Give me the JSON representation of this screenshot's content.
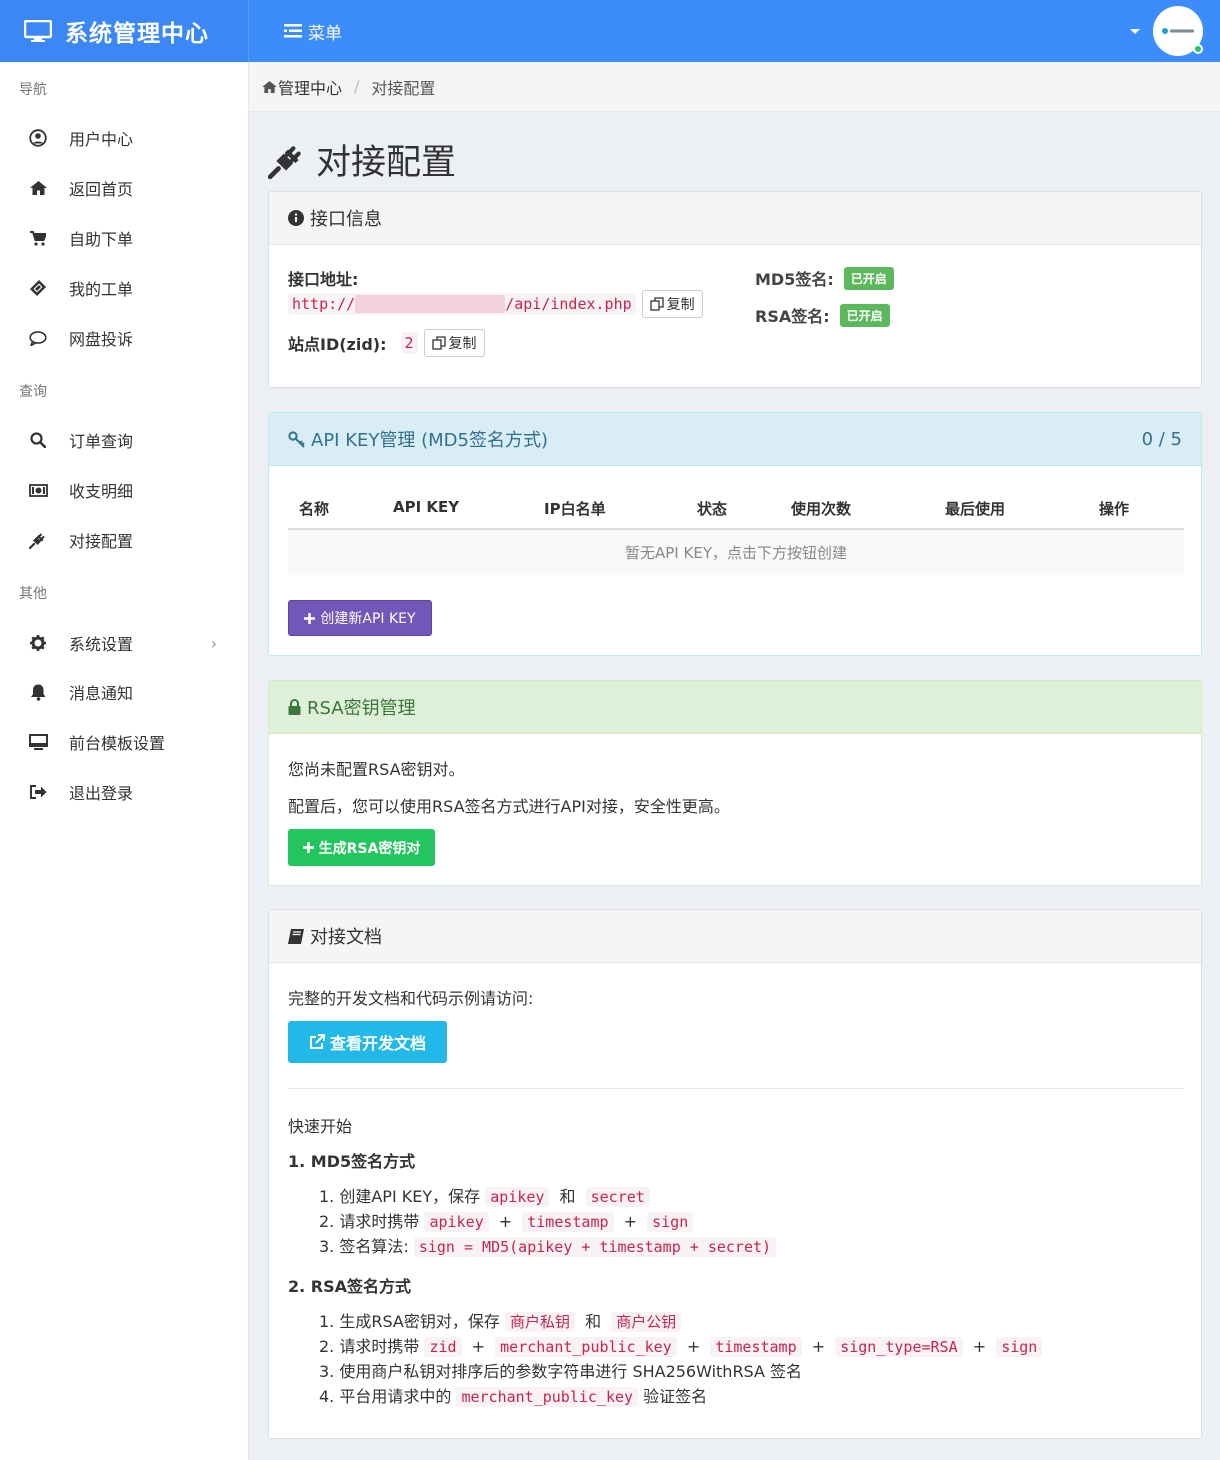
{
  "header": {
    "brand": "系统管理中心",
    "menu_label": "菜单"
  },
  "sidebar": {
    "sections": [
      "导航",
      "查询",
      "其他"
    ],
    "items": [
      {
        "label": "用户中心",
        "icon": "user-circle-icon"
      },
      {
        "label": "返回首页",
        "icon": "home-icon"
      },
      {
        "label": "自助下单",
        "icon": "cart-icon"
      },
      {
        "label": "我的工单",
        "icon": "ticket-icon"
      },
      {
        "label": "网盘投诉",
        "icon": "comment-icon"
      },
      {
        "label": "订单查询",
        "icon": "search-icon"
      },
      {
        "label": "收支明细",
        "icon": "money-icon"
      },
      {
        "label": "对接配置",
        "icon": "plug-icon"
      },
      {
        "label": "系统设置",
        "icon": "gear-icon"
      },
      {
        "label": "消息通知",
        "icon": "bell-icon"
      },
      {
        "label": "前台模板设置",
        "icon": "desktop-icon"
      },
      {
        "label": "退出登录",
        "icon": "sign-out-icon"
      }
    ]
  },
  "breadcrumb": {
    "home": "管理中心",
    "separator": "/",
    "current": "对接配置"
  },
  "page_title": "对接配置",
  "interface_panel": {
    "title": "接口信息",
    "api_url_label": "接口地址:",
    "api_url_prefix": "http://",
    "api_url_suffix": "/api/index.php",
    "copy_label": "复制",
    "site_id_label": "站点ID(zid):",
    "site_id_value": "2",
    "md5_label": "MD5签名:",
    "md5_status": "已开启",
    "rsa_label": "RSA签名:",
    "rsa_status": "已开启"
  },
  "apikey_panel": {
    "title": "API KEY管理 (MD5签名方式)",
    "count": "0 / 5",
    "columns": [
      "名称",
      "API KEY",
      "IP白名单",
      "状态",
      "使用次数",
      "最后使用",
      "操作"
    ],
    "empty_text": "暂无API KEY，点击下方按钮创建",
    "create_button": "创建新API KEY"
  },
  "rsa_panel": {
    "title": "RSA密钥管理",
    "line1": "您尚未配置RSA密钥对。",
    "line2": "配置后，您可以使用RSA签名方式进行API对接，安全性更高。",
    "generate_button": "生成RSA密钥对"
  },
  "docs_panel": {
    "title": "对接文档",
    "intro": "完整的开发文档和代码示例请访问:",
    "docs_button": "查看开发文档",
    "quick_start": "快速开始",
    "md5_heading": "1. MD5签名方式",
    "md5_steps": {
      "s1_prefix": "1. 创建API KEY，保存",
      "s1_code1": "apikey",
      "s1_and": "和",
      "s1_code2": "secret",
      "s2_prefix": "2. 请求时携带",
      "s2_code1": "apikey",
      "s2_code2": "timestamp",
      "s2_code3": "sign",
      "s3_prefix": "3. 签名算法:",
      "s3_code": "sign = MD5(apikey + timestamp + secret)"
    },
    "rsa_heading": "2. RSA签名方式",
    "rsa_steps": {
      "s1_prefix": "1. 生成RSA密钥对，保存",
      "s1_code1": "商户私钥",
      "s1_and": "和",
      "s1_code2": "商户公钥",
      "s2_prefix": "2. 请求时携带",
      "s2_code1": "zid",
      "s2_code2": "merchant_public_key",
      "s2_code3": "timestamp",
      "s2_code4": "sign_type=RSA",
      "s2_code5": "sign",
      "s3": "3. 使用商户私钥对排序后的参数字符串进行 SHA256WithRSA 签名",
      "s4_prefix": "4. 平台用请求中的",
      "s4_code": "merchant_public_key",
      "s4_suffix": "验证签名"
    },
    "plus": "+"
  },
  "colors": {
    "header_blue": "#3c8dfb",
    "purple_button": "#7357b8",
    "green_button": "#22c55e",
    "cyan_button": "#22b8e8",
    "label_green": "#5cb85c",
    "code_red": "#c7254e"
  }
}
